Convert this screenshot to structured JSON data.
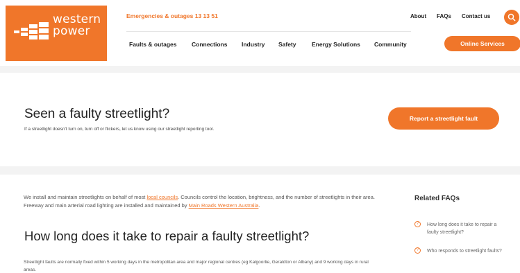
{
  "logo": {
    "line1": "western",
    "line2": "power"
  },
  "header": {
    "emergency": "Emergencies & outages 13 13 51",
    "util_links": [
      "About",
      "FAQs",
      "Contact us"
    ],
    "search_icon": "search-icon",
    "nav": [
      "Faults & outages",
      "Connections",
      "Industry",
      "Safety",
      "Energy Solutions",
      "Community"
    ],
    "online_services": "Online Services"
  },
  "banner": {
    "title": "Seen a faulty streetlight?",
    "description": "If a streetlight doesn't turn on, turn off or flickers, let us know using our streetlight reporting tool.",
    "report_button": "Report a streetlight fault"
  },
  "main": {
    "intro_part1": "We install and maintain streetlights on behalf of most ",
    "intro_link1": "local councils",
    "intro_part2": ". Councils control the location, brightness, and the number of streetlights in their area. Freeway and main arterial road lighting are installed and maintained by ",
    "intro_link2": "Main Roads Western Australia",
    "intro_part3": ".",
    "heading": "How long does it take to repair a faulty streetlight?",
    "paragraph": "Streetlight faults are normally fixed within 5 working days in the metropolitan area and major regional centres (eg Kalgoorlie, Geraldton or Albany) and 9 working days in rural areas."
  },
  "related": {
    "title": "Related FAQs",
    "items": [
      "How long does it take to repair a faulty streetlight?",
      "Who responds to streetlight faults?"
    ]
  },
  "colors": {
    "accent": "#f0762a"
  }
}
